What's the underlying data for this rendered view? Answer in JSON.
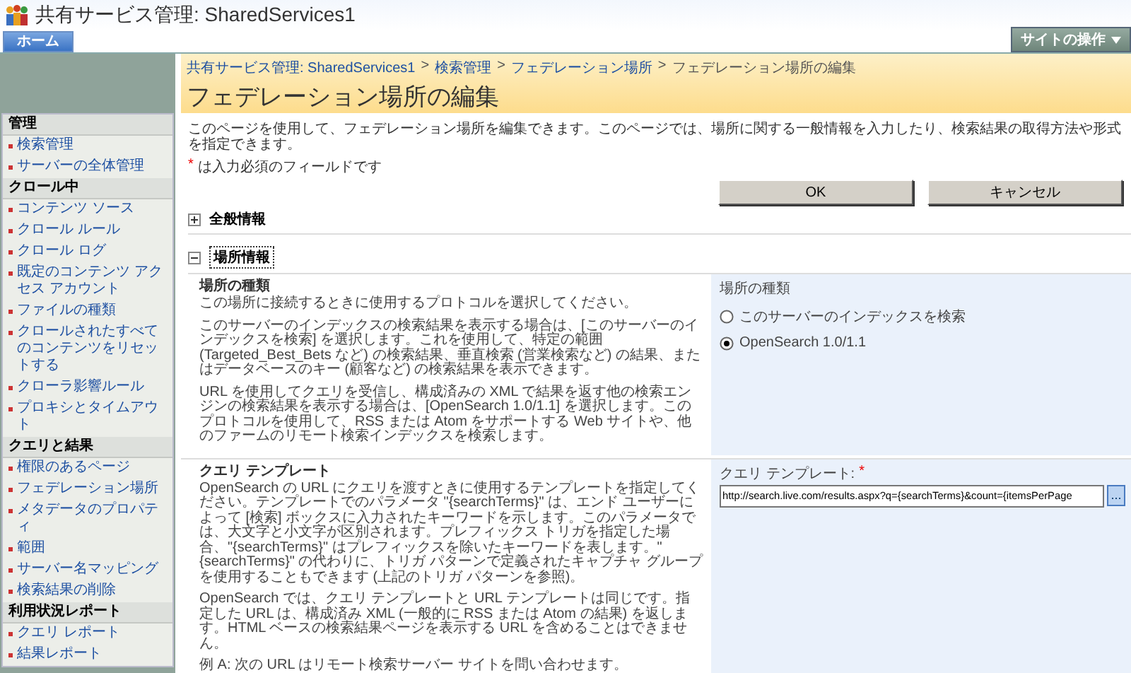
{
  "header": {
    "title": "共有サービス管理: SharedServices1"
  },
  "tabs": [
    {
      "label": "ホーム",
      "selected": true
    }
  ],
  "site_actions": {
    "label": "サイトの操作"
  },
  "sidebar": {
    "groups": [
      {
        "heading": "管理",
        "items": [
          "検索管理",
          "サーバーの全体管理"
        ]
      },
      {
        "heading": "クロール中",
        "items": [
          "コンテンツ ソース",
          "クロール ルール",
          "クロール ログ",
          "既定のコンテンツ アクセス アカウント",
          "ファイルの種類",
          "クロールされたすべてのコンテンツをリセットする",
          "クローラ影響ルール",
          "プロキシとタイムアウト"
        ]
      },
      {
        "heading": "クエリと結果",
        "items": [
          "権限のあるページ",
          "フェデレーション場所",
          "メタデータのプロパティ",
          "範囲",
          "サーバー名マッピング",
          "検索結果の削除"
        ]
      },
      {
        "heading": "利用状況レポート",
        "items": [
          "クエリ レポート",
          "結果レポート"
        ]
      }
    ]
  },
  "breadcrumb": [
    {
      "kind": "link",
      "label": "共有サービス管理: SharedServices1"
    },
    {
      "kind": "separator",
      "label": ">"
    },
    {
      "kind": "link",
      "label": "検索管理"
    },
    {
      "kind": "separator",
      "label": ">"
    },
    {
      "kind": "link",
      "label": "フェデレーション場所"
    },
    {
      "kind": "separator",
      "label": ">"
    },
    {
      "kind": "current",
      "label": "フェデレーション場所の編集"
    }
  ],
  "page_title": "フェデレーション場所の編集",
  "description": "このページを使用して、フェデレーション場所を編集できます。このページでは、場所に関する一般情報を入力したり、検索結果の取得方法や形式を指定できます。",
  "required_note": {
    "mark": "*",
    "text": "は入力必須のフィールドです"
  },
  "buttons": [
    "OK",
    "キャンセル"
  ],
  "sections": [
    {
      "title": "全般情報",
      "expanded": false
    },
    {
      "title": "場所情報",
      "expanded": true,
      "fields": [
        {
          "kind": "radio",
          "heading": "場所の種類",
          "paragraphs": [
            "この場所に接続するときに使用するプロトコルを選択してください。",
            "このサーバーのインデックスの検索結果を表示する場合は、[このサーバーのインデックスを検索] を選択します。これを使用して、特定の範囲 (Targeted_Best_Bets など) の検索結果、垂直検索 (営業検索など) の結果、またはデータベースのキー (顧客など) の検索結果を表示できます。",
            "URL を使用してクエリを受信し、構成済みの XML で結果を返す他の検索エンジンの検索結果を表示する場合は、[OpenSearch 1.0/1.1] を選択します。このプロトコルを使用して、RSS または Atom をサポートする Web サイトや、他のファームのリモート検索インデックスを検索します。"
          ],
          "label": "場所の種類",
          "options": [
            {
              "label": "このサーバーのインデックスを検索",
              "selected": false
            },
            {
              "label": "OpenSearch 1.0/1.1",
              "selected": true
            }
          ]
        },
        {
          "kind": "text",
          "heading": "クエリ テンプレート",
          "paragraphs": [
            "OpenSearch の URL にクエリを渡すときに使用するテンプレートを指定してください。テンプレートでのパラメータ \"{searchTerms}\" は、エンド ユーザーによって [検索] ボックスに入力されたキーワードを示します。このパラメータでは、大文字と小文字が区別されます。プレフィックス トリガを指定した場合、\"{searchTerms}\" はプレフィックスを除いたキーワードを表します。\"{searchTerms}\" の代わりに、トリガ パターンで定義されたキャプチャ グループを使用することもできます (上記のトリガ パターンを参照)。",
            "OpenSearch では、クエリ テンプレートと URL テンプレートは同じです。指定した URL は、構成済み XML (一般的に RSS または Atom の結果) を返します。HTML ベースの検索結果ページを表示する URL を含めることはできません。",
            "例 A: 次の URL はリモート検索サーバー サイトを問い合わせます。"
          ],
          "label": "クエリ テンプレート:",
          "required_mark": "*",
          "value": "http://search.live.com/results.aspx?q={searchTerms}&count={itemsPerPage",
          "browse_button": "..."
        }
      ]
    }
  ]
}
